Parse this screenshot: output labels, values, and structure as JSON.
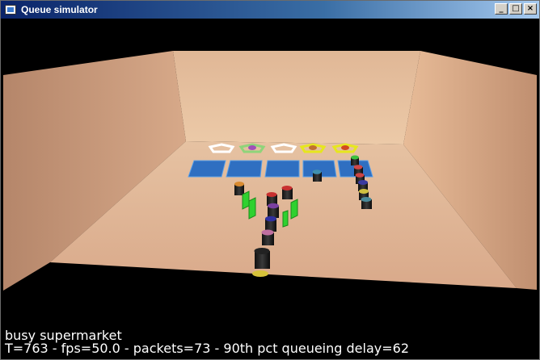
{
  "window": {
    "title": "Queue simulator",
    "controls": {
      "minimize": "_",
      "maximize": "□",
      "close": "×"
    }
  },
  "hud": {
    "scenario": "busy supermarket",
    "stats": "T=763 - fps=50.0 - packets=73 - 90th pct queueing delay=62"
  },
  "colors": {
    "background": "#000000",
    "floor": "#e2b48e",
    "back_wall": "#e9c3a0",
    "side_wall": "#c99b7a",
    "server_pad": "#2f73c8",
    "server_ring_idle": "#ffffff",
    "server_ring_yellow": "#e6e61e",
    "queue_gate": "#2fd12f"
  },
  "icons": [
    "app-icon",
    "minimize-icon",
    "maximize-icon",
    "close-icon"
  ]
}
